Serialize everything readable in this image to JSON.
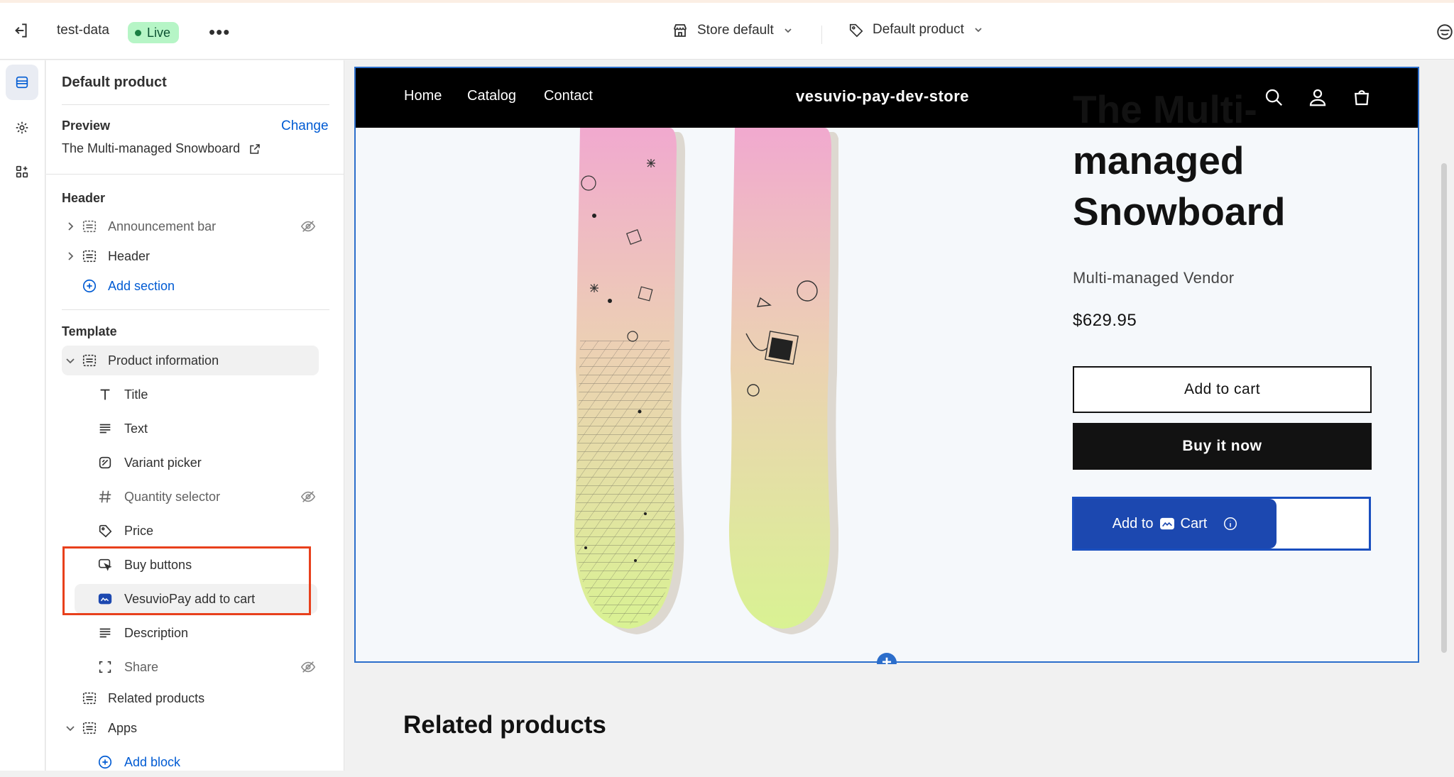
{
  "topbar": {
    "store_name": "test-data",
    "status_badge": "Live",
    "theme_selector": "Store default",
    "template_selector": "Default product"
  },
  "sidebar": {
    "title": "Default product",
    "preview_label": "Preview",
    "change_link": "Change",
    "preview_product": "The Multi-managed Snowboard",
    "header_group_label": "Header",
    "header_items": [
      "Announcement bar",
      "Header"
    ],
    "add_section": "Add section",
    "template_group_label": "Template",
    "product_information": "Product information",
    "blocks": [
      "Title",
      "Text",
      "Variant picker",
      "Quantity selector",
      "Price",
      "Buy buttons",
      "VesuvioPay add to cart",
      "Description",
      "Share"
    ],
    "related_products": "Related products",
    "apps": "Apps",
    "add_block": "Add block"
  },
  "store": {
    "nav": [
      "Home",
      "Catalog",
      "Contact"
    ],
    "name": "vesuvio-pay-dev-store",
    "product_title": "The Multi-managed Snowboard",
    "vendor": "Multi-managed Vendor",
    "price": "$629.95",
    "add_to_cart": "Add to cart",
    "buy_now": "Buy it now",
    "vp_add_to": "Add to",
    "vp_cart": "Cart",
    "related_heading": "Related products"
  },
  "colors": {
    "accent": "#2c6ecb",
    "live_badge": "#b6f5c6",
    "highlight_box": "#e8401c",
    "vesuviopay_blue": "#1c48b0"
  }
}
